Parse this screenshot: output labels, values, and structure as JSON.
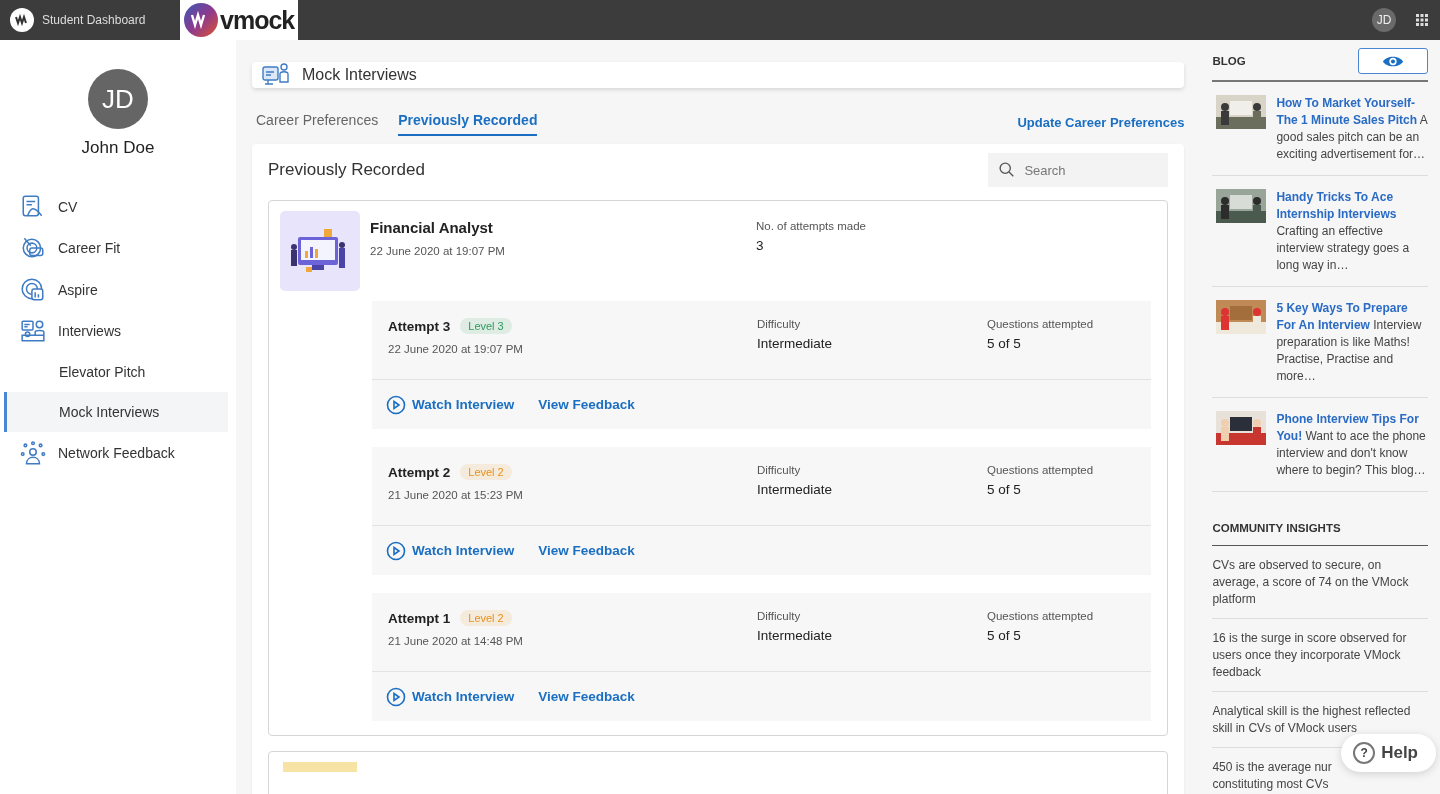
{
  "topbar": {
    "app_title": "Student Dashboard",
    "brand": "vmock",
    "user_initials": "JD"
  },
  "profile": {
    "initials": "JD",
    "name": "John Doe"
  },
  "sidebar": {
    "items": [
      {
        "label": "CV",
        "selected": false
      },
      {
        "label": "Career Fit",
        "selected": false
      },
      {
        "label": "Aspire",
        "selected": false
      },
      {
        "label": "Interviews",
        "selected": false,
        "children": [
          {
            "label": "Elevator Pitch",
            "selected": false
          },
          {
            "label": "Mock Interviews",
            "selected": true
          }
        ]
      },
      {
        "label": "Network Feedback",
        "selected": false
      }
    ]
  },
  "header": {
    "title": "Mock Interviews"
  },
  "tabs": [
    {
      "label": "Career Preferences",
      "selected": false
    },
    {
      "label": "Previously Recorded",
      "selected": true
    }
  ],
  "update_link": "Update Career Preferences",
  "panel": {
    "title": "Previously Recorded",
    "search": {
      "placeholder": "Search"
    }
  },
  "interview": {
    "role": "Financial Analyst",
    "date": "22 June 2020 at 19:07 PM",
    "attempts_label": "No. of attempts made",
    "attempts": "3",
    "attempt_list": [
      {
        "title": "Attempt 3",
        "level": "Level 3",
        "color": "#2e9a5e",
        "date": "22 June 2020 at 19:07 PM",
        "difficulty_label": "Difficulty",
        "difficulty": "Intermediate",
        "questions_label": "Questions attempted",
        "questions": "5 of 5",
        "watch": "Watch Interview",
        "feedback": "View Feedback"
      },
      {
        "title": "Attempt 2",
        "level": "Level 2",
        "color": "#e8901c",
        "date": "21 June 2020 at 15:23 PM",
        "difficulty_label": "Difficulty",
        "difficulty": "Intermediate",
        "questions_label": "Questions attempted",
        "questions": "5 of 5",
        "watch": "Watch Interview",
        "feedback": "View Feedback"
      },
      {
        "title": "Attempt 1",
        "level": "Level 2",
        "color": "#e8901c",
        "date": "21 June 2020 at 14:48 PM",
        "difficulty_label": "Difficulty",
        "difficulty": "Intermediate",
        "questions_label": "Questions attempted",
        "questions": "5 of 5",
        "watch": "Watch Interview",
        "feedback": "View Feedback"
      }
    ]
  },
  "blog": {
    "title": "BLOG",
    "posts": [
      {
        "text": "**How To Market Yourself- The 1 Minute Sales Pitch** A good sales pitch can be an exciting advertisement for…"
      },
      {
        "text": "**Handy Tricks To Ace Internship Interviews** Crafting an effective interview strategy goes a long way in…"
      },
      {
        "text": "**5 Key Ways To Prepare For An Interview** Interview preparation is like Maths! Practise, Practise and more…"
      },
      {
        "text": "**Phone Interview Tips For You!** Want to ace the phone interview and don't know where to begin? This blog…"
      }
    ]
  },
  "insights": {
    "title": "COMMUNITY INSIGHTS",
    "items": [
      {
        "lines": [
          "CVs are observed to secure, on average, a score of 74 on the VMock platform"
        ]
      },
      {
        "lines": [
          "16 is the surge in score observed for users once they incorporate VMock feedback"
        ]
      },
      {
        "lines": [
          "Analytical skill is the highest reflected skill in CVs of VMock users"
        ]
      },
      {
        "lines": [
          "450 is the average nur",
          "constituting most CVs"
        ]
      }
    ]
  },
  "help": {
    "icon": "?",
    "label": "Help"
  }
}
